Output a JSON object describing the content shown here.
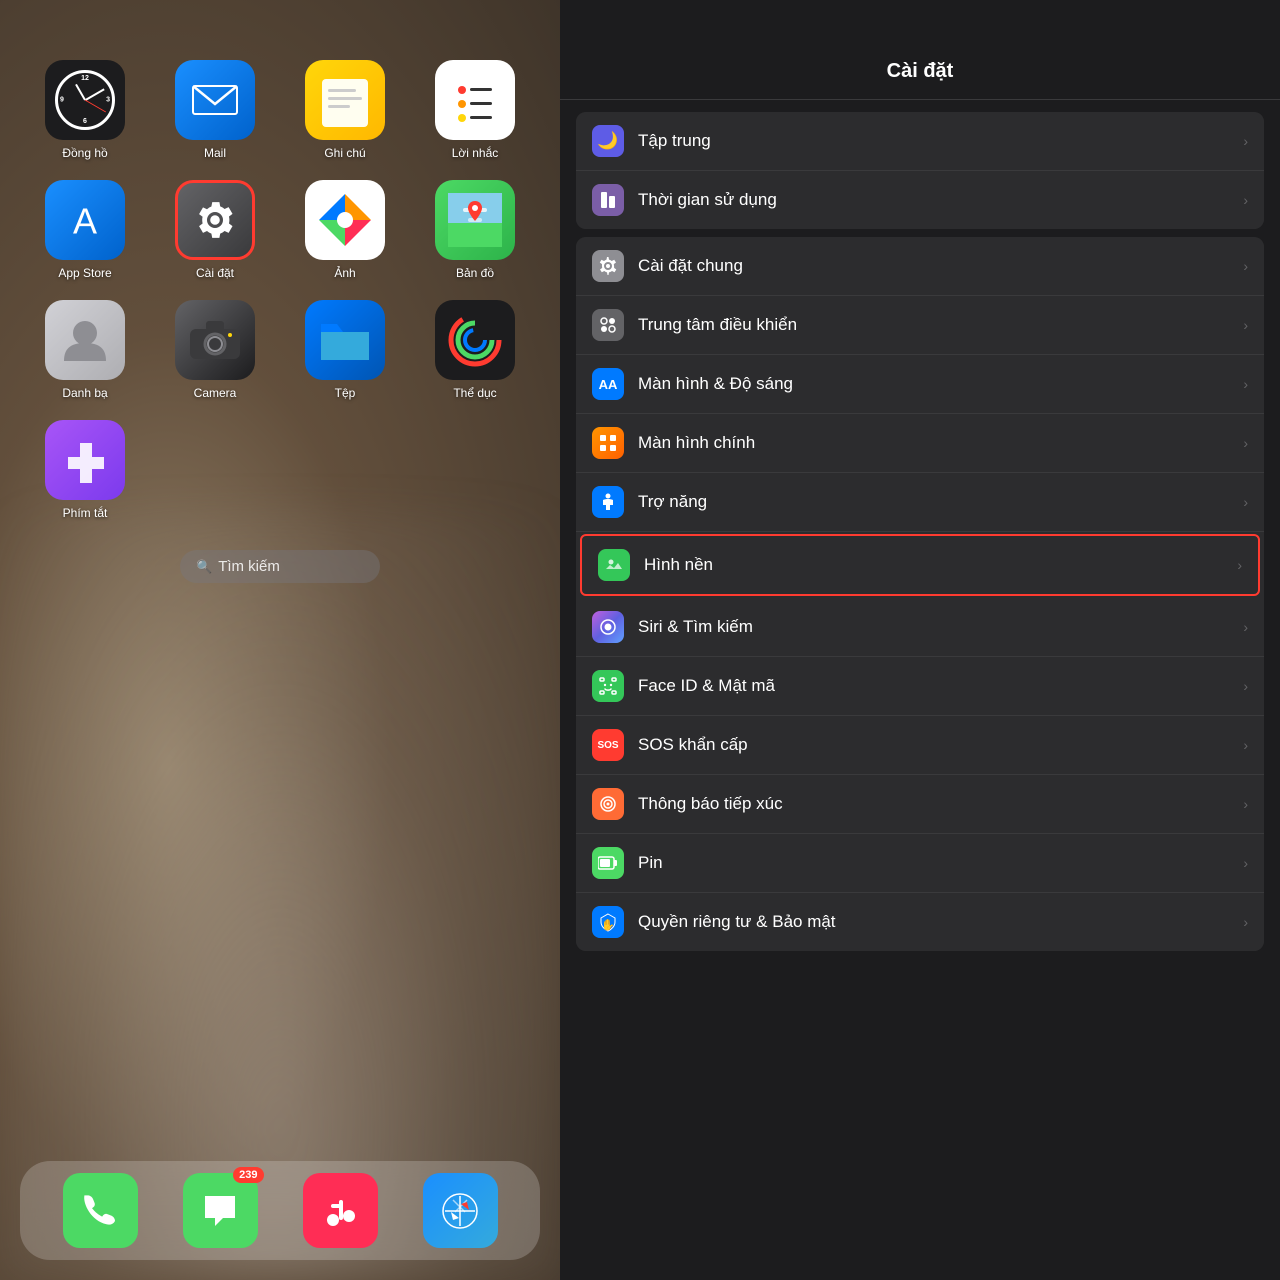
{
  "leftPanel": {
    "apps": [
      {
        "id": "clock",
        "label": "Đồng hồ",
        "icon": "clock"
      },
      {
        "id": "mail",
        "label": "Mail",
        "icon": "mail"
      },
      {
        "id": "notes",
        "label": "Ghi chú",
        "icon": "notes"
      },
      {
        "id": "reminders",
        "label": "Lời nhắc",
        "icon": "reminders"
      },
      {
        "id": "appstore",
        "label": "App Store",
        "icon": "appstore"
      },
      {
        "id": "settings",
        "label": "Cài đặt",
        "icon": "settings",
        "highlighted": true
      },
      {
        "id": "photos",
        "label": "Ảnh",
        "icon": "photos"
      },
      {
        "id": "maps",
        "label": "Bản đồ",
        "icon": "maps"
      },
      {
        "id": "contacts",
        "label": "Danh bạ",
        "icon": "contacts"
      },
      {
        "id": "camera",
        "label": "Camera",
        "icon": "camera"
      },
      {
        "id": "files",
        "label": "Tệp",
        "icon": "files"
      },
      {
        "id": "fitness",
        "label": "Thể dục",
        "icon": "fitness"
      },
      {
        "id": "shortcuts",
        "label": "Phím tắt",
        "icon": "shortcuts"
      }
    ],
    "searchBar": {
      "icon": "🔍",
      "placeholder": "Tìm kiếm"
    },
    "dock": [
      {
        "id": "phone",
        "label": "Phone",
        "icon": "phone"
      },
      {
        "id": "messages",
        "label": "Messages",
        "icon": "messages",
        "badge": "239"
      },
      {
        "id": "music",
        "label": "Music",
        "icon": "music"
      },
      {
        "id": "safari",
        "label": "Safari",
        "icon": "safari"
      }
    ]
  },
  "rightPanel": {
    "title": "Cài đặt",
    "groups": [
      {
        "items": [
          {
            "id": "focus",
            "label": "Tập trung",
            "iconBg": "#5e5ce6",
            "iconText": "🌙"
          },
          {
            "id": "screen-time",
            "label": "Thời gian sử dụng",
            "iconBg": "#7b5ea7",
            "iconText": "⏱"
          }
        ]
      },
      {
        "items": [
          {
            "id": "general",
            "label": "Cài đặt chung",
            "iconBg": "#8e8e93",
            "iconText": "⚙️"
          },
          {
            "id": "control-center",
            "label": "Trung tâm điều khiển",
            "iconBg": "#636366",
            "iconText": "⚙"
          },
          {
            "id": "display",
            "label": "Màn hình & Độ sáng",
            "iconBg": "#007aff",
            "iconText": "AA"
          },
          {
            "id": "homescreen",
            "label": "Màn hình chính",
            "iconBg": "#ff6000",
            "iconText": "⊞"
          },
          {
            "id": "accessibility",
            "label": "Trợ năng",
            "iconBg": "#007aff",
            "iconText": "♿"
          },
          {
            "id": "wallpaper",
            "label": "Hình nền",
            "iconBg": "#34c759",
            "iconText": "✦",
            "highlighted": true
          },
          {
            "id": "siri",
            "label": "Siri & Tìm kiếm",
            "iconBg": "siri",
            "iconText": "◉"
          },
          {
            "id": "faceid",
            "label": "Face ID & Mật mã",
            "iconBg": "#34c759",
            "iconText": "😊"
          },
          {
            "id": "sos",
            "label": "SOS khẩn cấp",
            "iconBg": "#ff3b30",
            "iconText": "SOS"
          },
          {
            "id": "contact-tracing",
            "label": "Thông báo tiếp xúc",
            "iconBg": "#ff6b35",
            "iconText": "◎"
          },
          {
            "id": "battery",
            "label": "Pin",
            "iconBg": "#4cd964",
            "iconText": "▮"
          },
          {
            "id": "privacy",
            "label": "Quyền riêng tư & Bảo mật",
            "iconBg": "#007aff",
            "iconText": "✋"
          }
        ]
      }
    ]
  }
}
